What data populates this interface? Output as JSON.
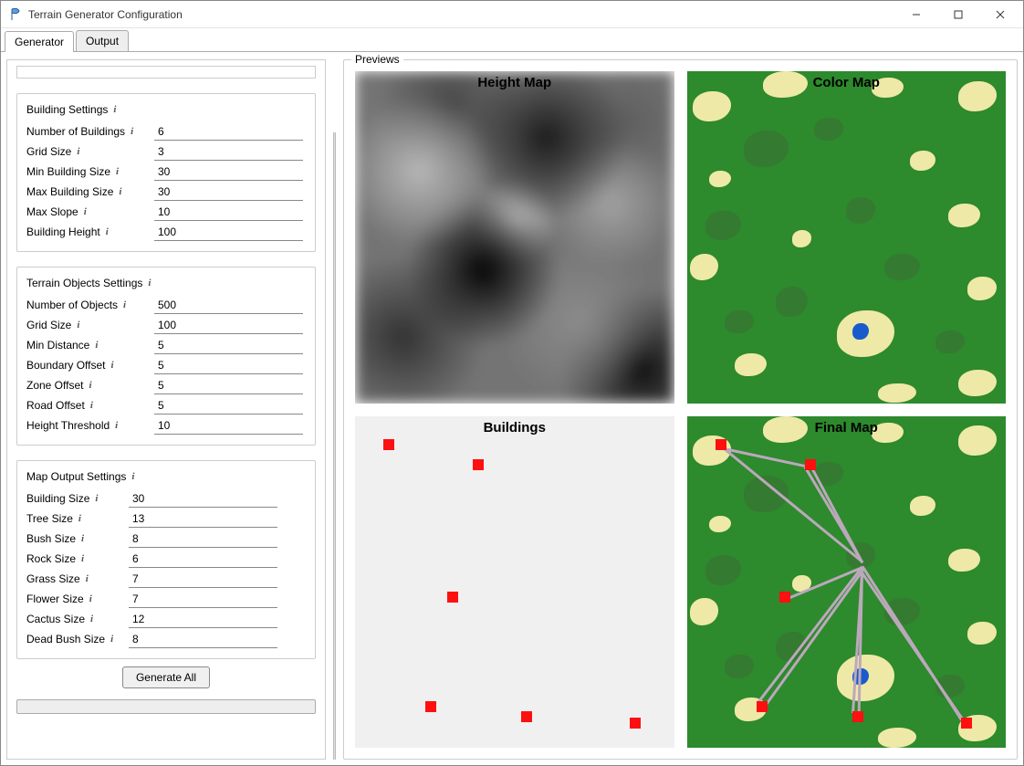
{
  "window": {
    "title": "Terrain Generator Configuration"
  },
  "tabs": {
    "generator": "Generator",
    "output": "Output"
  },
  "sections": {
    "building": {
      "title": "Building Settings",
      "fields": {
        "num_buildings": {
          "label": "Number of Buildings",
          "value": "6"
        },
        "grid_size": {
          "label": "Grid Size",
          "value": "3"
        },
        "min_building_size": {
          "label": "Min Building Size",
          "value": "30"
        },
        "max_building_size": {
          "label": "Max Building Size",
          "value": "30"
        },
        "max_slope": {
          "label": "Max Slope",
          "value": "10"
        },
        "building_height": {
          "label": "Building Height",
          "value": "100"
        }
      }
    },
    "terrain_objects": {
      "title": "Terrain Objects Settings",
      "fields": {
        "num_objects": {
          "label": "Number of Objects",
          "value": "500"
        },
        "grid_size": {
          "label": "Grid Size",
          "value": "100"
        },
        "min_distance": {
          "label": "Min Distance",
          "value": "5"
        },
        "boundary_offset": {
          "label": "Boundary Offset",
          "value": "5"
        },
        "zone_offset": {
          "label": "Zone Offset",
          "value": "5"
        },
        "road_offset": {
          "label": "Road Offset",
          "value": "5"
        },
        "height_threshold": {
          "label": "Height Threshold",
          "value": "10"
        }
      }
    },
    "map_output": {
      "title": "Map Output Settings",
      "fields": {
        "building_size": {
          "label": "Building Size",
          "value": "30"
        },
        "tree_size": {
          "label": "Tree Size",
          "value": "13"
        },
        "bush_size": {
          "label": "Bush Size",
          "value": "8"
        },
        "rock_size": {
          "label": "Rock Size",
          "value": "6"
        },
        "grass_size": {
          "label": "Grass Size",
          "value": "7"
        },
        "flower_size": {
          "label": "Flower Size",
          "value": "7"
        },
        "cactus_size": {
          "label": "Cactus Size",
          "value": "12"
        },
        "dead_bush_size": {
          "label": "Dead Bush Size",
          "value": "8"
        }
      }
    }
  },
  "buttons": {
    "generate_all": "Generate All"
  },
  "previews": {
    "legend": "Previews",
    "heightmap": "Height Map",
    "colormap": "Color Map",
    "buildings": "Buildings",
    "finalmap": "Final Map"
  },
  "info_char": "i",
  "building_points": [
    {
      "x": 9,
      "y": 7
    },
    {
      "x": 37,
      "y": 13
    },
    {
      "x": 29,
      "y": 53
    },
    {
      "x": 22,
      "y": 86
    },
    {
      "x": 52,
      "y": 89
    },
    {
      "x": 86,
      "y": 91
    }
  ]
}
